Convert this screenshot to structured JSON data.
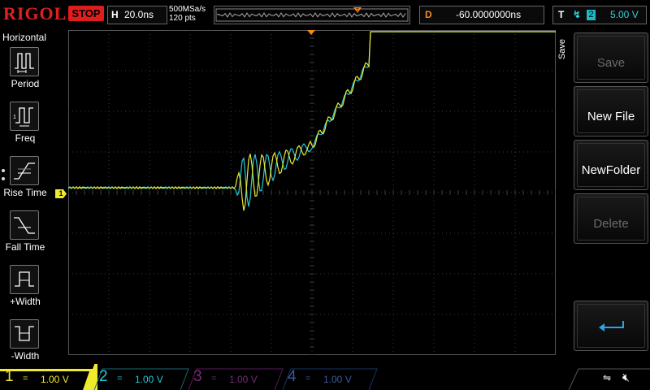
{
  "brand": "RIGOL",
  "run_state": "STOP",
  "horizontal": {
    "key": "H",
    "timebase": "20.0ns",
    "sample_rate": "500MSa/s",
    "points": "120 pts"
  },
  "delay": {
    "key": "D",
    "value": "-60.0000000ns"
  },
  "trigger": {
    "key": "T",
    "edge_symbol": "↯",
    "source": "2",
    "level": "5.00 V"
  },
  "left_menu": {
    "title": "Horizontal",
    "items": [
      {
        "label": "Period",
        "icon": "period-icon"
      },
      {
        "label": "Freq",
        "icon": "frequency-icon"
      },
      {
        "label": "Rise Time",
        "icon": "rise-time-icon"
      },
      {
        "label": "Fall Time",
        "icon": "fall-time-icon"
      },
      {
        "label": "+Width",
        "icon": "positive-width-icon"
      },
      {
        "label": "-Width",
        "icon": "negative-width-icon"
      }
    ]
  },
  "right_menu": {
    "title": "Save",
    "softkeys": [
      {
        "label": "Save",
        "enabled": false
      },
      {
        "label": "New File",
        "enabled": true
      },
      {
        "label": "NewFolder",
        "enabled": true
      },
      {
        "label": "Delete",
        "enabled": false
      }
    ],
    "back_icon": "return-arrow-icon"
  },
  "channels": [
    {
      "num": "1",
      "coupling": "=",
      "scale": "1.00 V",
      "color": "#f0ea2c",
      "active": true
    },
    {
      "num": "2",
      "coupling": "=",
      "scale": "1.00 V",
      "color": "#22c8d8",
      "active": true
    },
    {
      "num": "3",
      "coupling": "=",
      "scale": "1.00 V",
      "color": "#c21fc4",
      "active": false
    },
    {
      "num": "4",
      "coupling": "=",
      "scale": "1.00 V",
      "color": "#3a7de0",
      "active": false
    }
  ],
  "ch1_marker": "1",
  "status_icons": [
    "usb-icon",
    "speaker-muted-icon"
  ],
  "colors": {
    "ch1": "#f0ea2c",
    "ch2": "#22c8d8",
    "stop": "#e01c1c",
    "trigger_marker": "#f58a1f",
    "grid": "#3a3a3a"
  }
}
